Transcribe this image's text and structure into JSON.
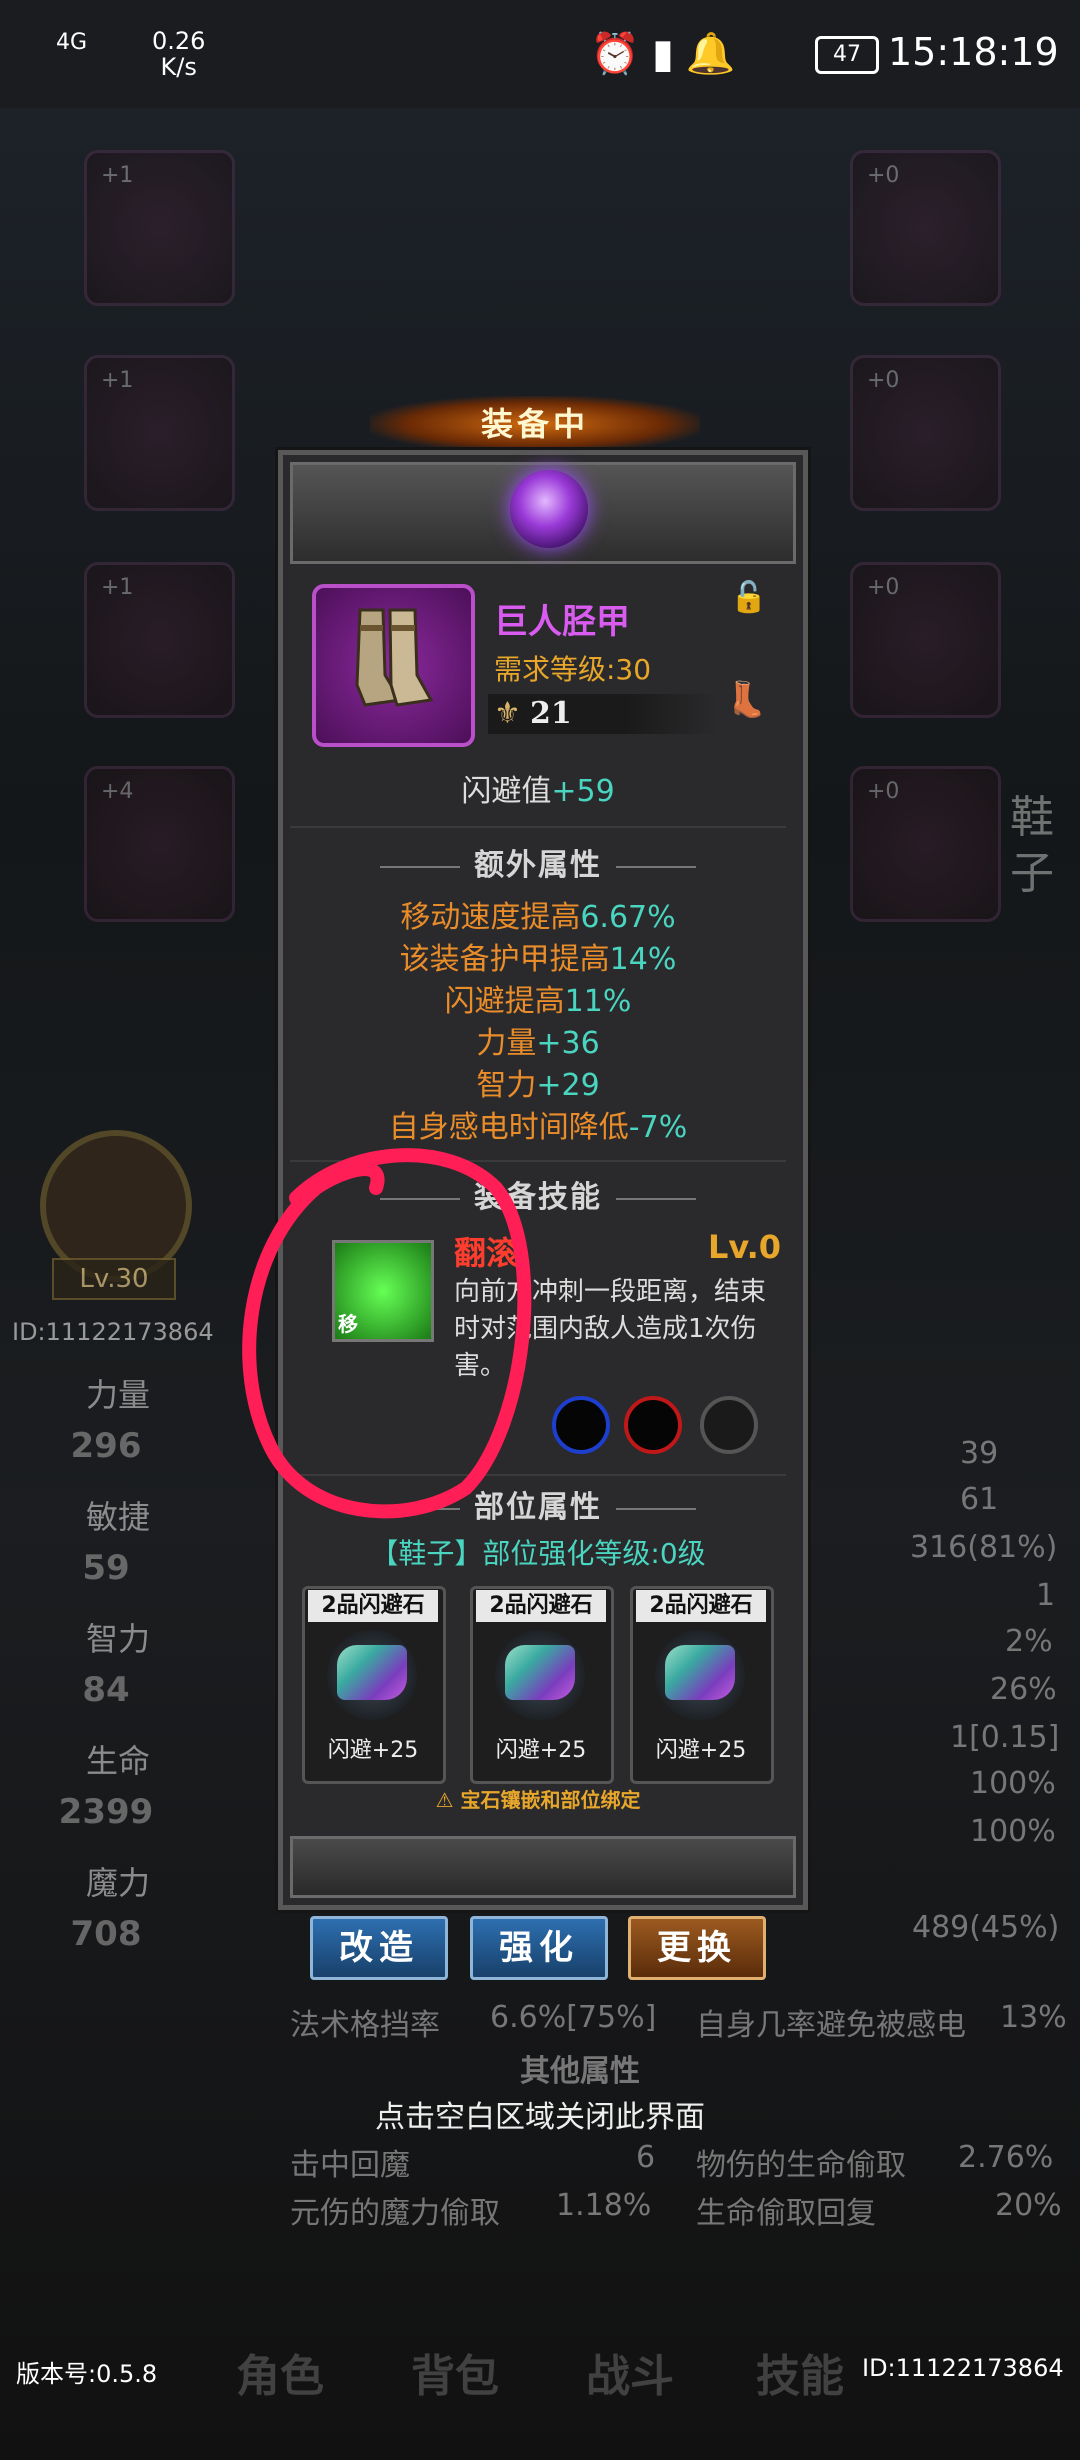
{
  "status_bar": {
    "network": "4G",
    "speed": "0.26",
    "speed_unit": "K/s",
    "battery": "47",
    "time": "15:18:19"
  },
  "background": {
    "side_stats": [
      {
        "name": "力量",
        "value": "296"
      },
      {
        "name": "敏捷",
        "value": "59"
      },
      {
        "name": "智力",
        "value": "84"
      },
      {
        "name": "生命",
        "value": "2399"
      },
      {
        "name": "魔力",
        "value": "708"
      }
    ],
    "avatar_level": "Lv.30",
    "player_id": "ID:11122173864",
    "slot_levels": [
      "+1",
      "+1",
      "+1",
      "+4",
      "+0",
      "+0",
      "+0",
      "+0"
    ],
    "right_slot_label": "鞋子",
    "right_values": [
      "39",
      "61",
      "316(81%)",
      "1",
      "2%",
      "26%",
      "1[0.15]",
      "100%",
      "100%",
      "489(45%)"
    ],
    "bottom_rows": [
      {
        "left": "法术格挡率",
        "lv": "6.6%[75%]",
        "right": "自身几率避免被感电",
        "rv": "13%"
      },
      {
        "left": "击中回魔",
        "lv": "6",
        "right": "物伤的生命偷取",
        "rv": "2.76%"
      },
      {
        "left": "元伤的魔力偷取",
        "lv": "1.18%",
        "right": "生命偷取回复",
        "rv": "20%"
      }
    ],
    "other_attrs_title": "其他属性",
    "close_hint": "点击空白区域关闭此界面",
    "version": "版本号:0.5.8",
    "bottom_id": "ID:11122173864",
    "nav": [
      "角色",
      "背包",
      "战斗",
      "技能"
    ]
  },
  "panel": {
    "equipped_label": "装备中",
    "item": {
      "name": "巨人胫甲",
      "required_level": "需求等级:30",
      "power": "21",
      "base_attr_label": "闪避值",
      "base_attr_value": "+59"
    },
    "extra_attrs_title": "额外属性",
    "extra_attrs": [
      {
        "label": "移动速度提高",
        "value": "6.67%"
      },
      {
        "label": "该装备护甲提高",
        "value": "14%"
      },
      {
        "label": "闪避提高",
        "value": "11%"
      },
      {
        "label": "力量",
        "value": "+36"
      },
      {
        "label": "智力",
        "value": "+29"
      },
      {
        "label": "自身感电时间降低",
        "value": "-7%"
      }
    ],
    "skill_title": "装备技能",
    "skill": {
      "icon_label": "移",
      "name": "翻滚",
      "level": "Lv.0",
      "description": "向前方冲刺一段距离，结束时对范围内敌人造成1次伤害。"
    },
    "part_title": "部位属性",
    "part_level": {
      "slot": "【鞋子】",
      "label": "部位强化等级:",
      "value": "0级"
    },
    "gems": [
      {
        "title": "2品闪避石",
        "stat": "闪避+25"
      },
      {
        "title": "2品闪避石",
        "stat": "闪避+25"
      },
      {
        "title": "2品闪避石",
        "stat": "闪避+25"
      }
    ],
    "gem_bind_note": "宝石镶嵌和部位绑定",
    "buttons": {
      "reforge": "改造",
      "enhance": "强化",
      "replace": "更换"
    }
  },
  "colors": {
    "item_name": "#d95bf0",
    "attr_orange": "#e98c2a",
    "attr_cyan": "#49d5c0",
    "skill_name": "#ff3d2e",
    "annotation": "#ff1e55"
  }
}
